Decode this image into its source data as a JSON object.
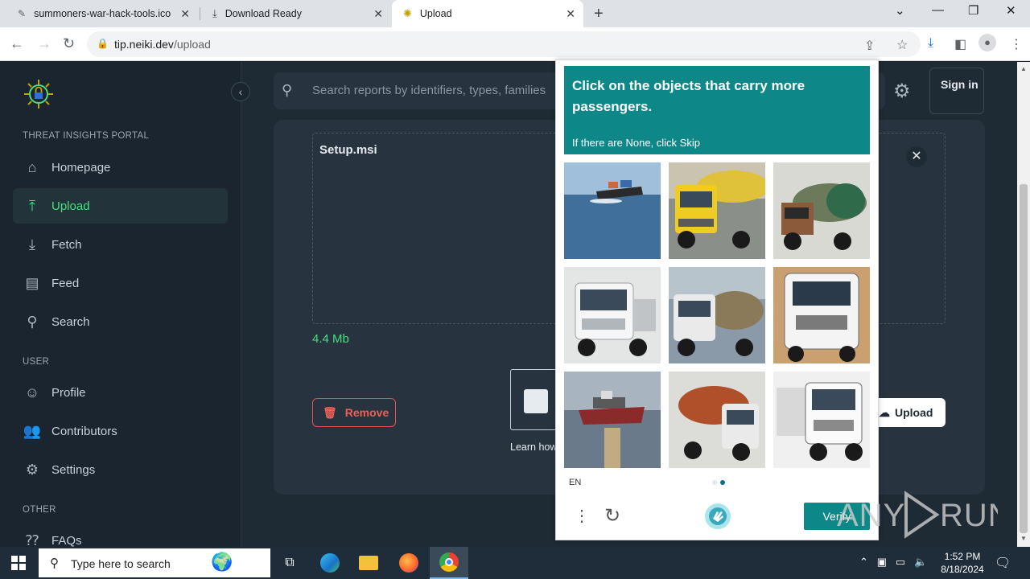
{
  "browser": {
    "tabs": [
      {
        "title": "summoners-war-hack-tools.ico",
        "favicon": "page-icon",
        "active": false
      },
      {
        "title": "Download Ready",
        "favicon": "download-icon",
        "active": false
      },
      {
        "title": "Upload",
        "favicon": "site-logo-icon",
        "active": true
      }
    ],
    "url_host": "tip.neiki.dev",
    "url_path": "/upload"
  },
  "sidebar": {
    "section_portal": "THREAT INSIGHTS PORTAL",
    "section_user": "USER",
    "section_other": "OTHER",
    "items": [
      {
        "label": "Homepage",
        "icon": "home-icon",
        "active": false
      },
      {
        "label": "Upload",
        "icon": "upload-icon",
        "active": true
      },
      {
        "label": "Fetch",
        "icon": "fetch-icon",
        "active": false
      },
      {
        "label": "Feed",
        "icon": "feed-icon",
        "active": false
      },
      {
        "label": "Search",
        "icon": "search-icon",
        "active": false
      },
      {
        "label": "Profile",
        "icon": "profile-icon",
        "active": false
      },
      {
        "label": "Contributors",
        "icon": "contributors-icon",
        "active": false
      },
      {
        "label": "Settings",
        "icon": "gear-icon",
        "active": false
      },
      {
        "label": "FAQs",
        "icon": "faq-icon",
        "active": false
      }
    ]
  },
  "header": {
    "search_placeholder": "Search reports by identifiers, types, families",
    "signin_label": "Sign in"
  },
  "upload": {
    "filename": "Setup.msi",
    "filesize": "4.4 Mb",
    "remove_label": "Remove",
    "upload_label": "Upload",
    "learn_how": "Learn how"
  },
  "captcha": {
    "title": "Click on the objects that carry more passengers.",
    "subtitle": "If there are None, click Skip",
    "language": "EN",
    "verify_label": "Verify",
    "tiles": [
      "ship",
      "yellow-truck",
      "tanker-truck",
      "white-truck",
      "tanker-truck",
      "white-truck",
      "ship",
      "tanker-truck",
      "white-truck"
    ],
    "page_indicator": {
      "pages": 2,
      "current": 2
    }
  },
  "watermark": "ANY RUN",
  "taskbar": {
    "search_placeholder": "Type here to search",
    "time": "1:52 PM",
    "date": "8/18/2024"
  },
  "colors": {
    "accent_green": "#4ade80",
    "captcha_teal": "#0e8789",
    "remove_red": "#ef5f55",
    "page_bg": "#1e2a34"
  }
}
